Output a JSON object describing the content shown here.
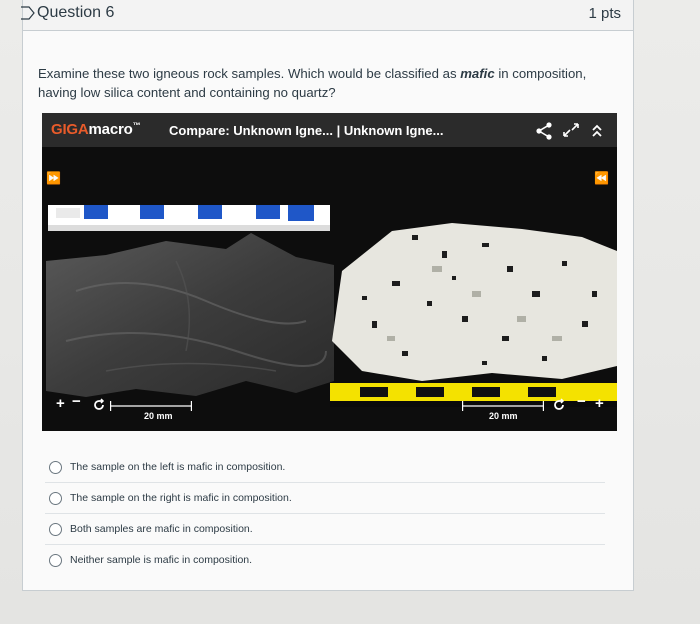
{
  "question": {
    "title": "Question 6",
    "points": "1 pts",
    "prompt_before": "Examine these two igneous rock samples. Which would be classified as ",
    "prompt_emph": "mafic",
    "prompt_after": " in composition, having low silica content and containing no quartz?"
  },
  "viewer": {
    "logo_giga": "GIGA",
    "logo_macro": "macro",
    "logo_tm": "™",
    "title": "Compare: Unknown Igne... | Unknown Igne...",
    "left_scale": "20 mm",
    "right_scale": "20 mm",
    "forward_icon": "⏩",
    "back_icon": "⏪"
  },
  "options": [
    {
      "label": "The sample on the left is mafic in composition."
    },
    {
      "label": "The sample on the right is mafic in composition."
    },
    {
      "label": "Both samples are mafic in composition."
    },
    {
      "label": "Neither sample is mafic in composition."
    }
  ],
  "colors": {
    "accent": "#e85b2a",
    "scale_blue": "#1f57c8",
    "scale_yellow": "#f4e200"
  }
}
